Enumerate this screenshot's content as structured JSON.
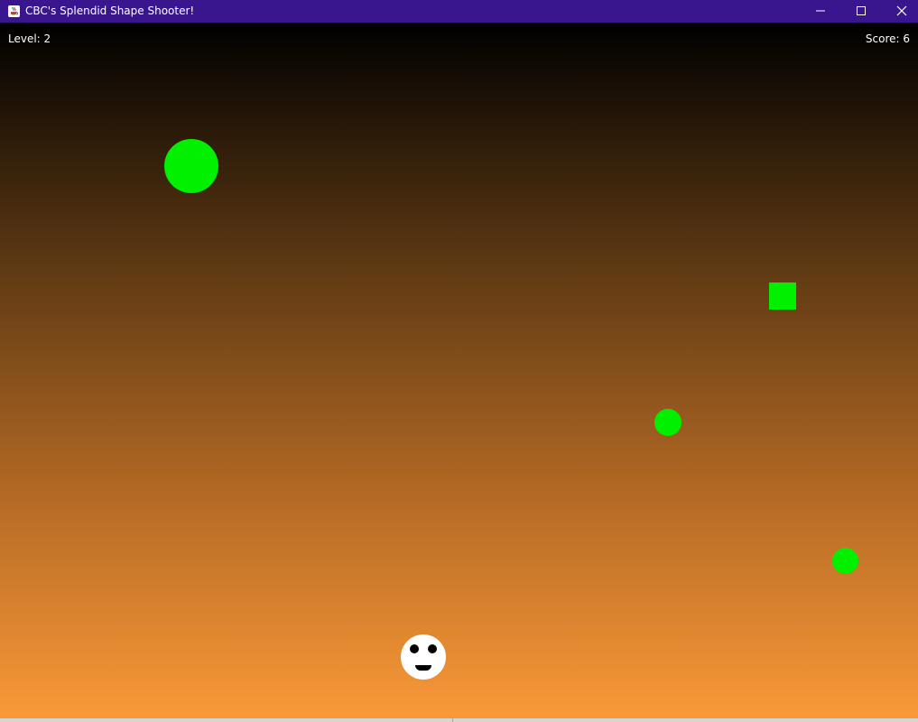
{
  "window": {
    "title": "CBC's Splendid Shape Shooter!",
    "titlebar_color": "#39168e",
    "icons": {
      "app": "java-cup-icon",
      "minimize": "minimize-icon",
      "maximize": "maximize-icon",
      "close": "close-icon"
    }
  },
  "hud": {
    "level_text": "Level: 2",
    "score_text": "Score: 6"
  },
  "game": {
    "background_gradient": {
      "top": "#000000",
      "bottom": "#fa9938"
    },
    "shape_color": "#00f000",
    "player_color": "#ffffff"
  }
}
